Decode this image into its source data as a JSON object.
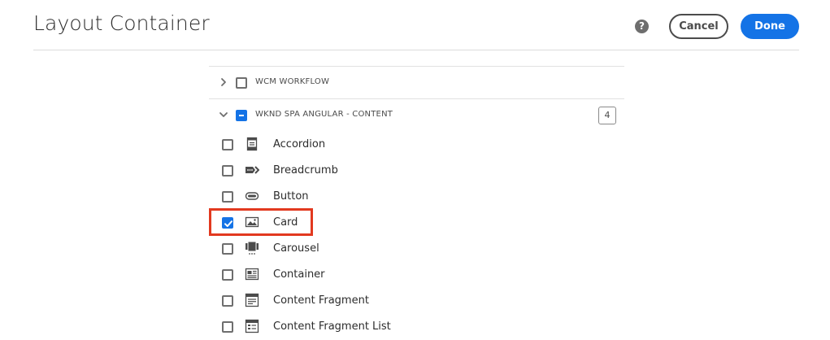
{
  "header": {
    "title": "Layout Container",
    "help_icon": "?",
    "cancel_label": "Cancel",
    "done_label": "Done"
  },
  "colors": {
    "accent": "#1473e6",
    "highlight": "#e2391f"
  },
  "groups": [
    {
      "label": "WCM WORKFLOW",
      "expanded": false,
      "checkbox": "unchecked",
      "icon": "chevron-right-icon"
    },
    {
      "label": "WKND SPA ANGULAR - CONTENT",
      "expanded": true,
      "checkbox": "indeterminate",
      "count": "4",
      "icon": "chevron-down-icon"
    }
  ],
  "items": [
    {
      "label": "Accordion",
      "checked": false,
      "icon": "accordion-icon"
    },
    {
      "label": "Breadcrumb",
      "checked": false,
      "icon": "breadcrumb-icon"
    },
    {
      "label": "Button",
      "checked": false,
      "icon": "button-icon"
    },
    {
      "label": "Card",
      "checked": true,
      "icon": "image-icon"
    },
    {
      "label": "Carousel",
      "checked": false,
      "icon": "carousel-icon"
    },
    {
      "label": "Container",
      "checked": false,
      "icon": "container-icon"
    },
    {
      "label": "Content Fragment",
      "checked": false,
      "icon": "content-fragment-icon"
    },
    {
      "label": "Content Fragment List",
      "checked": false,
      "icon": "content-fragment-list-icon"
    }
  ]
}
